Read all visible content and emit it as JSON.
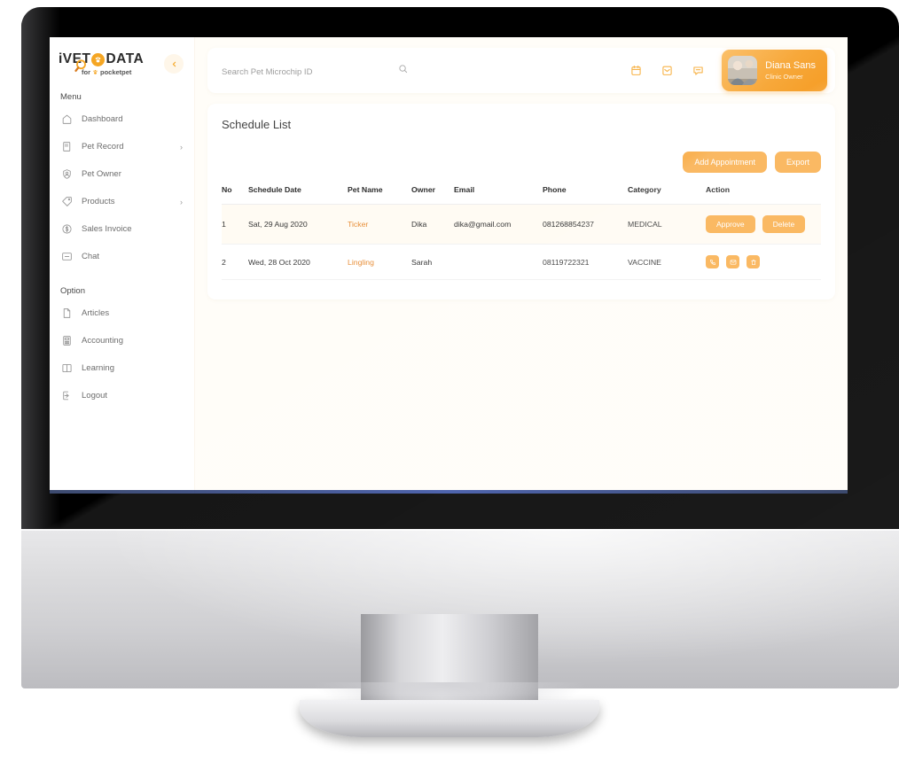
{
  "brand": {
    "logo_part1": "iVET",
    "logo_part2": "DATA",
    "logo_paw_icon": "paw-icon",
    "tagline_prefix": "for",
    "tagline_brand": "pocketpet",
    "accent_color": "#F5A623",
    "button_color": "#F9B254",
    "pet_name_color": "#E8903B",
    "page_bg": "#FFFDF8"
  },
  "sidebar": {
    "collapse_icon": "chevron-left-icon",
    "sections": [
      {
        "label": "Menu",
        "items": [
          {
            "label": "Dashboard",
            "icon": "home-icon",
            "has_chevron": false
          },
          {
            "label": "Pet Record",
            "icon": "document-icon",
            "has_chevron": true
          },
          {
            "label": "Pet Owner",
            "icon": "user-shield-icon",
            "has_chevron": false
          },
          {
            "label": "Products",
            "icon": "tag-icon",
            "has_chevron": true
          },
          {
            "label": "Sales Invoice",
            "icon": "dollar-circle-icon",
            "has_chevron": false
          },
          {
            "label": "Chat",
            "icon": "chat-icon",
            "has_chevron": false
          }
        ]
      },
      {
        "label": "Option",
        "items": [
          {
            "label": "Articles",
            "icon": "article-icon",
            "has_chevron": false
          },
          {
            "label": "Accounting",
            "icon": "calculator-icon",
            "has_chevron": false
          },
          {
            "label": "Learning",
            "icon": "book-icon",
            "has_chevron": false
          },
          {
            "label": "Logout",
            "icon": "logout-icon",
            "has_chevron": false
          }
        ]
      }
    ]
  },
  "topbar": {
    "search": {
      "placeholder": "Search Pet Microchip ID",
      "value": "",
      "icon": "search-icon"
    },
    "icons": [
      {
        "name": "calendar-icon"
      },
      {
        "name": "inbox-icon"
      },
      {
        "name": "message-icon"
      }
    ],
    "profile": {
      "name": "Diana Sans",
      "role": "Clinic Owner",
      "avatar": "avatar-photo"
    }
  },
  "page": {
    "title": "Schedule List",
    "actions": [
      {
        "label": "Add Appointment",
        "name": "add-appointment-button"
      },
      {
        "label": "Export",
        "name": "export-button"
      }
    ]
  },
  "table": {
    "columns": [
      "No",
      "Schedule Date",
      "Pet Name",
      "Owner",
      "Email",
      "Phone",
      "Category",
      "Action"
    ],
    "rows": [
      {
        "no": "1",
        "date": "Sat, 29 Aug 2020",
        "pet": "Ticker",
        "owner": "Dika",
        "email": "dika@gmail.com",
        "phone": "081268854237",
        "category": "MEDICAL",
        "highlight": true,
        "action_type": "buttons",
        "buttons": [
          {
            "label": "Approve",
            "name": "approve-button"
          },
          {
            "label": "Delete",
            "name": "delete-button"
          }
        ]
      },
      {
        "no": "2",
        "date": "Wed, 28 Oct 2020",
        "pet": "Lingling",
        "owner": "Sarah",
        "email": "",
        "phone": "08119722321",
        "category": "VACCINE",
        "highlight": false,
        "action_type": "icons",
        "icons": [
          {
            "name": "phone-icon"
          },
          {
            "name": "envelope-icon"
          },
          {
            "name": "trash-icon"
          }
        ]
      }
    ]
  }
}
